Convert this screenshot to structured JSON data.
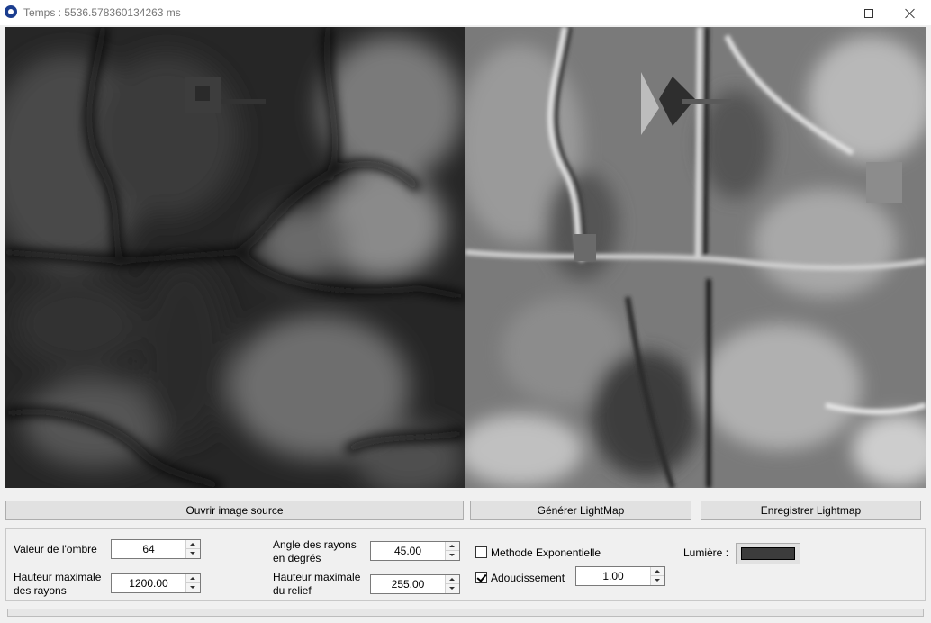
{
  "window": {
    "title": "Temps : 5536.578360134263 ms"
  },
  "icons": {
    "app": "paw-app-icon",
    "minimize": "minimize-icon",
    "maximize": "maximize-icon",
    "close": "close-icon"
  },
  "buttons": {
    "open_source": "Ouvrir image source",
    "generate": "Générer LightMap",
    "save": "Enregistrer Lightmap"
  },
  "options": {
    "shadow_value_label": "Valeur de l'ombre",
    "shadow_value": "64",
    "ray_height_label_1": "Hauteur maximale",
    "ray_height_label_2": "des rayons",
    "ray_height": "1200.00",
    "ray_angle_label_1": "Angle des rayons",
    "ray_angle_label_2": "en degrés",
    "ray_angle": "45.00",
    "relief_height_label_1": "Hauteur maximale",
    "relief_height_label_2": "du relief",
    "relief_height": "255.00",
    "exponential_label": "Methode Exponentielle",
    "exponential_checked": false,
    "smoothing_label": "Adoucissement",
    "smoothing_checked": true,
    "smoothing_value": "1.00",
    "light_label": "Lumière :",
    "light_color": "#3c3c3c"
  },
  "progress": {
    "fraction": 0
  }
}
